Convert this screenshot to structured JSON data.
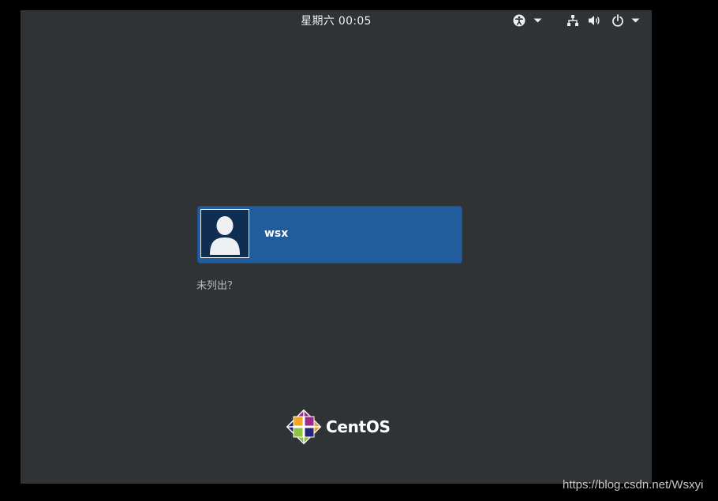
{
  "topbar": {
    "clock": "星期六 00:05",
    "icons": [
      "accessibility-icon",
      "chevron-down-icon",
      "network-icon",
      "volume-icon",
      "power-icon",
      "chevron-down-icon"
    ]
  },
  "login": {
    "users": [
      {
        "name": "wsx",
        "avatar": "user-avatar-icon"
      }
    ],
    "not_listed_label": "未列出？"
  },
  "branding": {
    "logo_text": "CentOS",
    "logo_colors": [
      "#9c2a8e",
      "#efa724",
      "#262577",
      "#8fc23e"
    ]
  },
  "watermark": "https://blog.csdn.net/Wsxyi",
  "colors": {
    "background": "#2e3234",
    "selected_user": "#215d9c",
    "text": "#eeeeec"
  }
}
